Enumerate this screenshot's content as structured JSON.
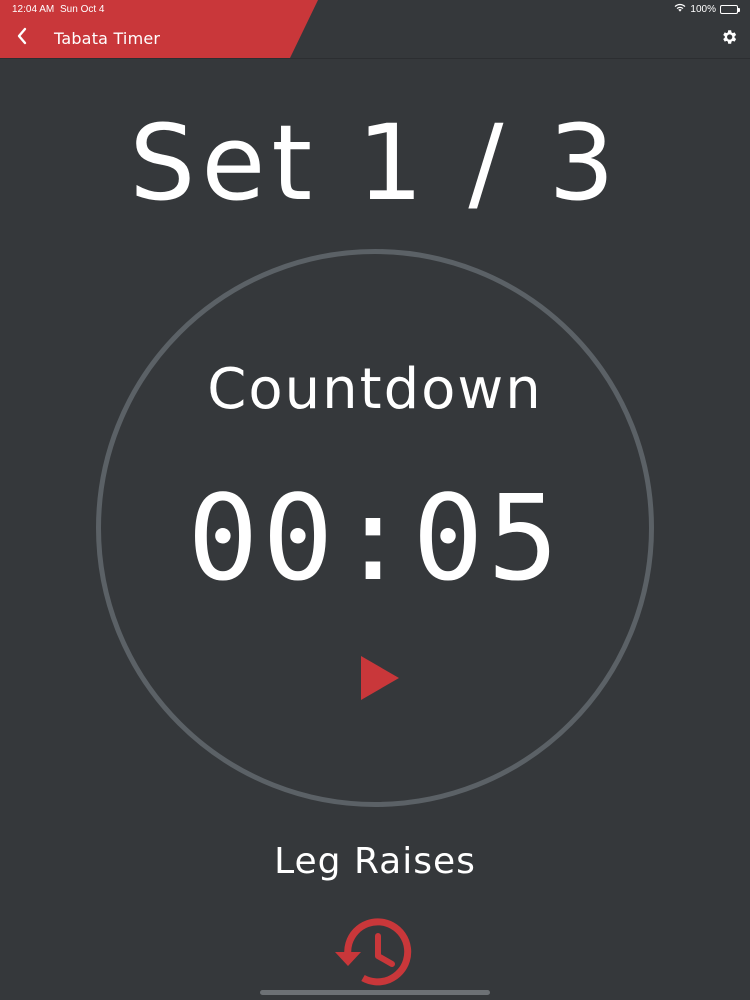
{
  "status_bar": {
    "time": "12:04 AM",
    "date": "Sun Oct 4",
    "battery": "100%",
    "battery_level": 1.0
  },
  "nav": {
    "title": "Tabata Timer",
    "back_icon": "chevron-left-icon",
    "settings_icon": "gear-icon"
  },
  "workout": {
    "set_label": "Set 1 / 3",
    "phase": "Countdown",
    "time": "00:05",
    "exercise": "Leg Raises"
  },
  "controls": {
    "play_icon": "play-icon",
    "history_icon": "history-icon"
  },
  "colors": {
    "background": "#35383b",
    "accent": "#c9373a",
    "ring": "#5b6166",
    "text": "#ffffff"
  }
}
